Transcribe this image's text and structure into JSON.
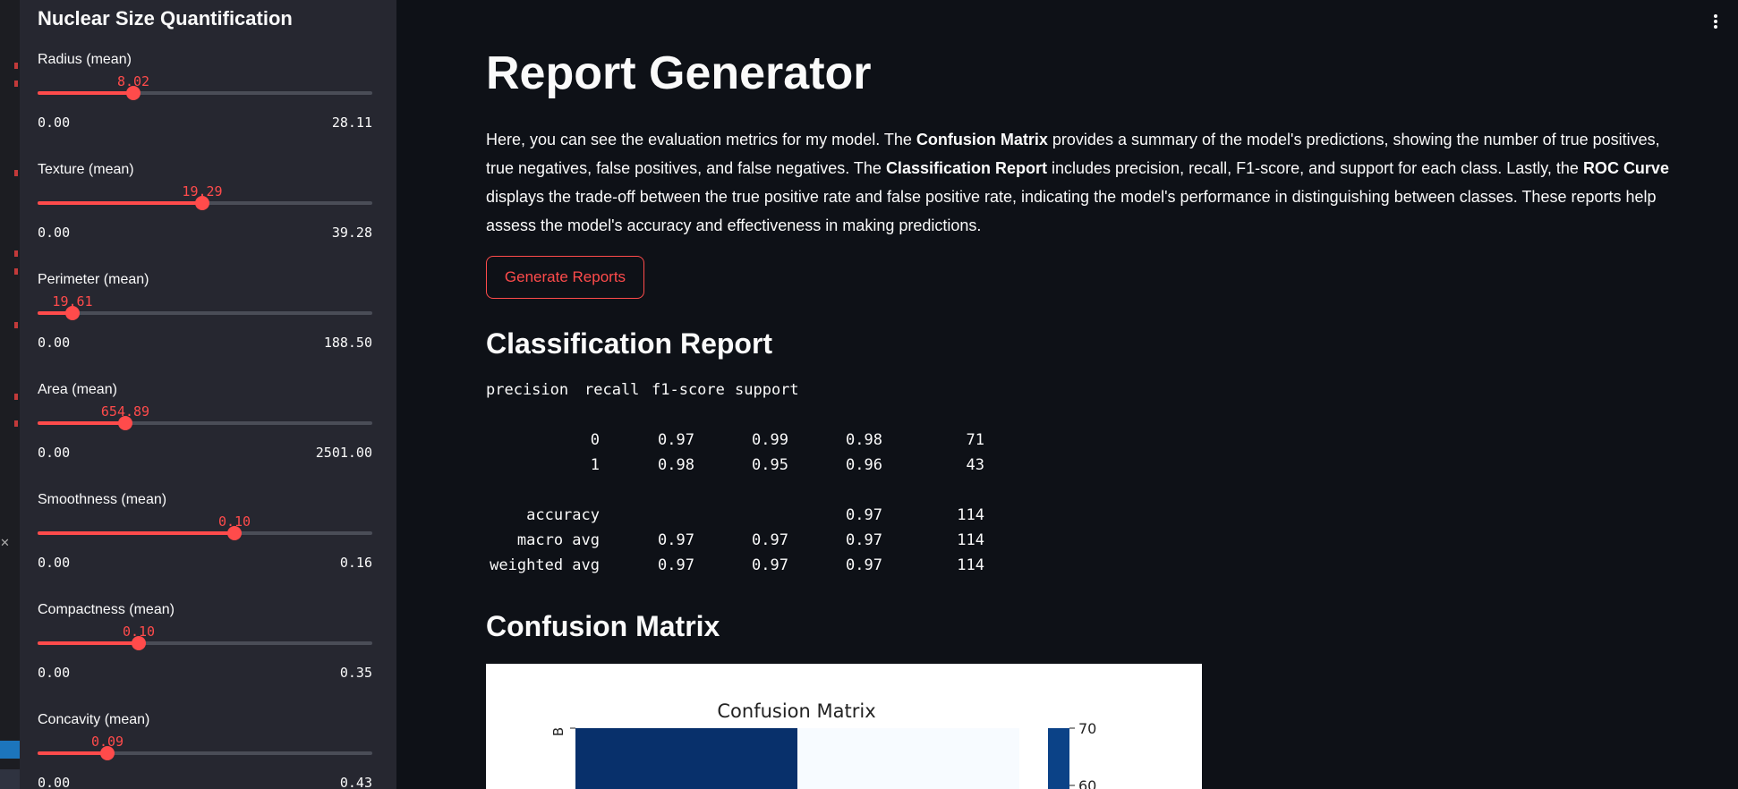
{
  "sidebar": {
    "title": "Nuclear Size Quantification",
    "sliders": [
      {
        "label": "Radius (mean)",
        "value": "8.02",
        "min": "0.00",
        "max": "28.11",
        "fraction": 0.285
      },
      {
        "label": "Texture (mean)",
        "value": "19.29",
        "min": "0.00",
        "max": "39.28",
        "fraction": 0.491
      },
      {
        "label": "Perimeter (mean)",
        "value": "19.61",
        "min": "0.00",
        "max": "188.50",
        "fraction": 0.104
      },
      {
        "label": "Area (mean)",
        "value": "654.89",
        "min": "0.00",
        "max": "2501.00",
        "fraction": 0.262
      },
      {
        "label": "Smoothness (mean)",
        "value": "0.10",
        "min": "0.00",
        "max": "0.16",
        "fraction": 0.588
      },
      {
        "label": "Compactness (mean)",
        "value": "0.10",
        "min": "0.00",
        "max": "0.35",
        "fraction": 0.301
      },
      {
        "label": "Concavity (mean)",
        "value": "0.09",
        "min": "0.00",
        "max": "0.43",
        "fraction": 0.209
      }
    ]
  },
  "main": {
    "title": "Report Generator",
    "intro": {
      "p1": "Here, you can see the evaluation metrics for my model. The ",
      "b1": "Confusion Matrix",
      "p2": " provides a summary of the model's predictions, showing the number of true positives, true negatives, false positives, and false negatives. The ",
      "b2": "Classification Report",
      "p3": " includes precision, recall, F1-score, and support for each class. Lastly, the ",
      "b3": "ROC Curve",
      "p4": " displays the trade-off between the true positive rate and false positive rate, indicating the model's performance in distinguishing between classes. These reports help assess the model's accuracy and effectiveness in making predictions."
    },
    "generate_button": "Generate Reports",
    "classification_heading": "Classification Report",
    "confusion_heading": "Confusion Matrix"
  },
  "report": {
    "headers": [
      "precision",
      "recall",
      "f1-score",
      "support"
    ],
    "rows": [
      {
        "label": "0",
        "precision": "0.97",
        "recall": "0.99",
        "f1": "0.98",
        "support": "71"
      },
      {
        "label": "1",
        "precision": "0.98",
        "recall": "0.95",
        "f1": "0.96",
        "support": "43"
      },
      {
        "label": "accuracy",
        "precision": "",
        "recall": "",
        "f1": "0.97",
        "support": "114"
      },
      {
        "label": "macro avg",
        "precision": "0.97",
        "recall": "0.97",
        "f1": "0.97",
        "support": "114"
      },
      {
        "label": "weighted avg",
        "precision": "0.97",
        "recall": "0.97",
        "f1": "0.97",
        "support": "114"
      }
    ]
  },
  "chart_data": {
    "type": "heatmap",
    "title": "Confusion Matrix",
    "row_labels": [
      "B"
    ],
    "colorbar_ticks": [
      "70",
      "60"
    ],
    "cells_visible": [
      {
        "row": "B",
        "col": 0,
        "color": "#08306b"
      },
      {
        "row": "B",
        "col": 1,
        "color": "#f7fbff"
      }
    ]
  },
  "colors": {
    "accent": "#ff4b4b",
    "background": "#0e1117",
    "sidebar": "#262730"
  }
}
